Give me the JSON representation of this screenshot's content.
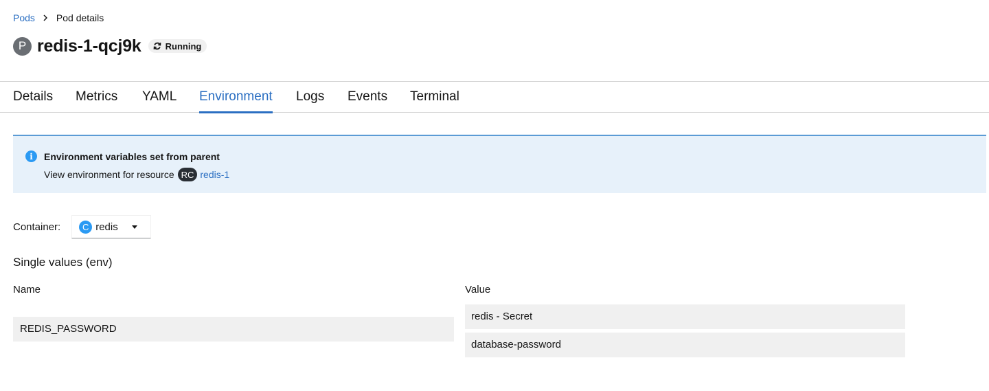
{
  "breadcrumb": {
    "parent": "Pods",
    "current": "Pod details"
  },
  "header": {
    "resource_badge": "P",
    "title": "redis-1-qcj9k",
    "status": "Running",
    "status_icon": "sync-icon"
  },
  "tabs": [
    {
      "label": "Details",
      "active": false
    },
    {
      "label": "Metrics",
      "active": false
    },
    {
      "label": "YAML",
      "active": false
    },
    {
      "label": "Environment",
      "active": true
    },
    {
      "label": "Logs",
      "active": false
    },
    {
      "label": "Events",
      "active": false
    },
    {
      "label": "Terminal",
      "active": false
    }
  ],
  "alert": {
    "icon": "info-icon",
    "title": "Environment variables set from parent",
    "body": "View environment for resource",
    "resource_badge": "RC",
    "resource_link": "redis-1"
  },
  "container": {
    "label": "Container:",
    "badge": "C",
    "selected": "redis"
  },
  "env": {
    "section_title": "Single values (env)",
    "name_header": "Name",
    "value_header": "Value",
    "name": "REDIS_PASSWORD",
    "value_source": "redis - Secret",
    "value_key": "database-password"
  },
  "colors": {
    "accent": "#2b6fc2",
    "alert_bg": "#e7f1fa",
    "field_bg": "#f0f0f0"
  }
}
